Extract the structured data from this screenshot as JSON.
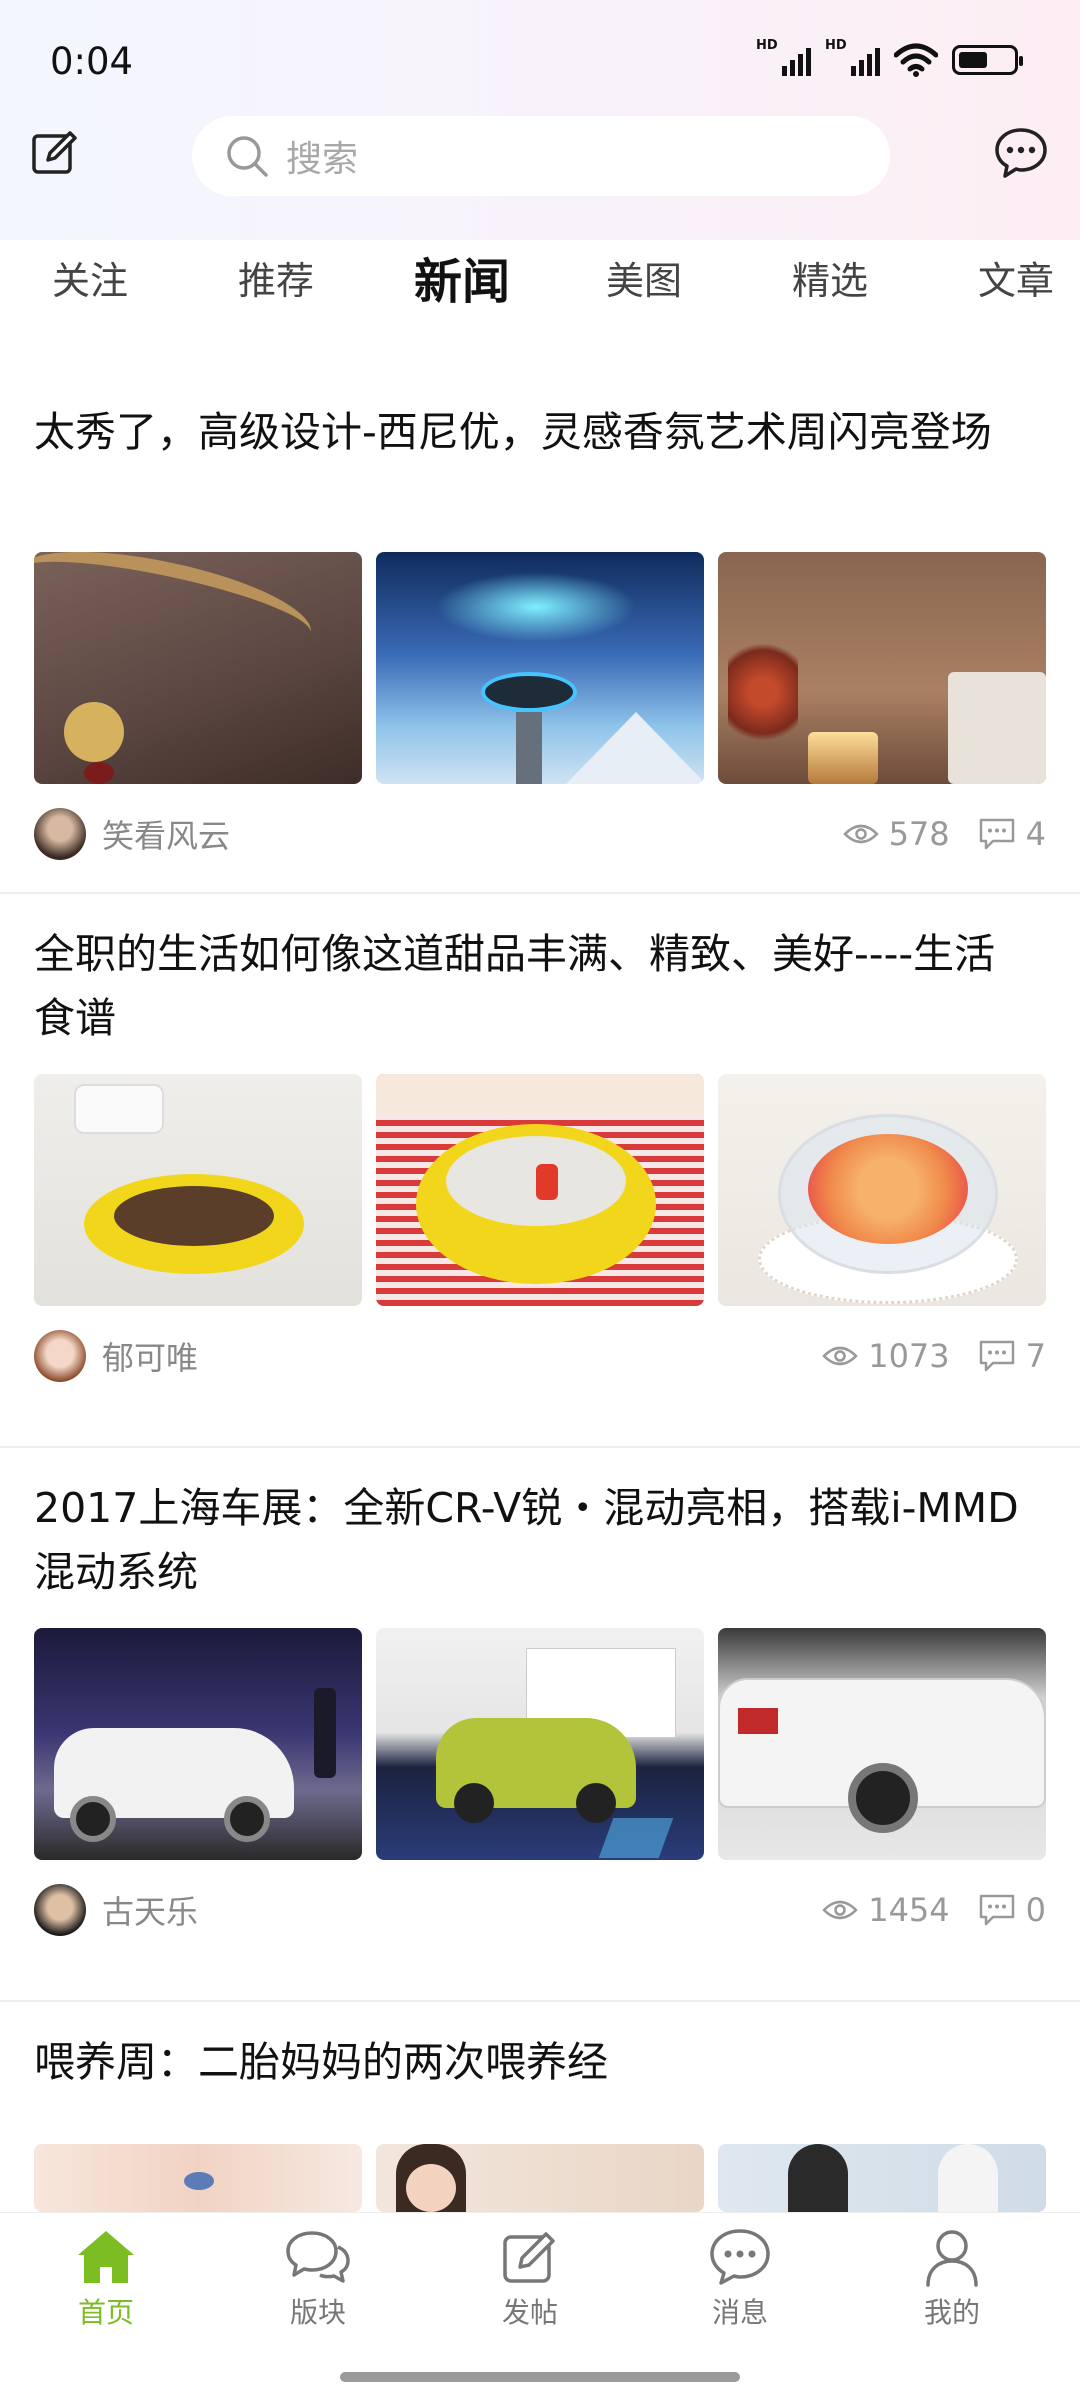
{
  "status_bar": {
    "time": "0:04",
    "hd_label": "HD"
  },
  "header": {
    "search_placeholder": "搜索"
  },
  "tabs": [
    {
      "label": "关注"
    },
    {
      "label": "推荐"
    },
    {
      "label": "新闻",
      "active": true
    },
    {
      "label": "美图"
    },
    {
      "label": "精选"
    },
    {
      "label": "文章"
    }
  ],
  "posts": [
    {
      "title": "太秀了，高级设计-西尼优，灵感香氛艺术周闪亮登场",
      "images": [
        "ribbon-sculpture-photo",
        "aurora-diffuser-photo",
        "candle-flowers-photo"
      ],
      "author": "笑看风云",
      "views": "578",
      "comments": "4"
    },
    {
      "title": "全职的生活如何像这道甜品丰满、精致、美好----生活食谱",
      "images": [
        "yellow-bowl-soup-photo",
        "yellow-bowl-congee-photo",
        "melon-dessert-photo"
      ],
      "author": "郁可唯",
      "views": "1073",
      "comments": "7"
    },
    {
      "title": "2017上海车展：全新CR-V锐・混动亮相，搭载i-MMD混动系统",
      "images": [
        "white-suv-stage-photo",
        "green-crv-showroom-photo",
        "white-crv-rear-photo"
      ],
      "author": "古天乐",
      "views": "1454",
      "comments": "0"
    },
    {
      "title": "喂养周：二胎妈妈的两次喂养经",
      "images": [
        "baby-photo",
        "nurse-photo",
        "family-photo"
      ]
    }
  ],
  "bottom_nav": [
    {
      "label": "首页",
      "icon": "home-icon",
      "active": true
    },
    {
      "label": "版块",
      "icon": "forum-icon"
    },
    {
      "label": "发帖",
      "icon": "compose-icon"
    },
    {
      "label": "消息",
      "icon": "message-icon"
    },
    {
      "label": "我的",
      "icon": "profile-icon"
    }
  ],
  "colors": {
    "accent": "#7cbd24",
    "text": "#111111",
    "muted": "#888888"
  }
}
